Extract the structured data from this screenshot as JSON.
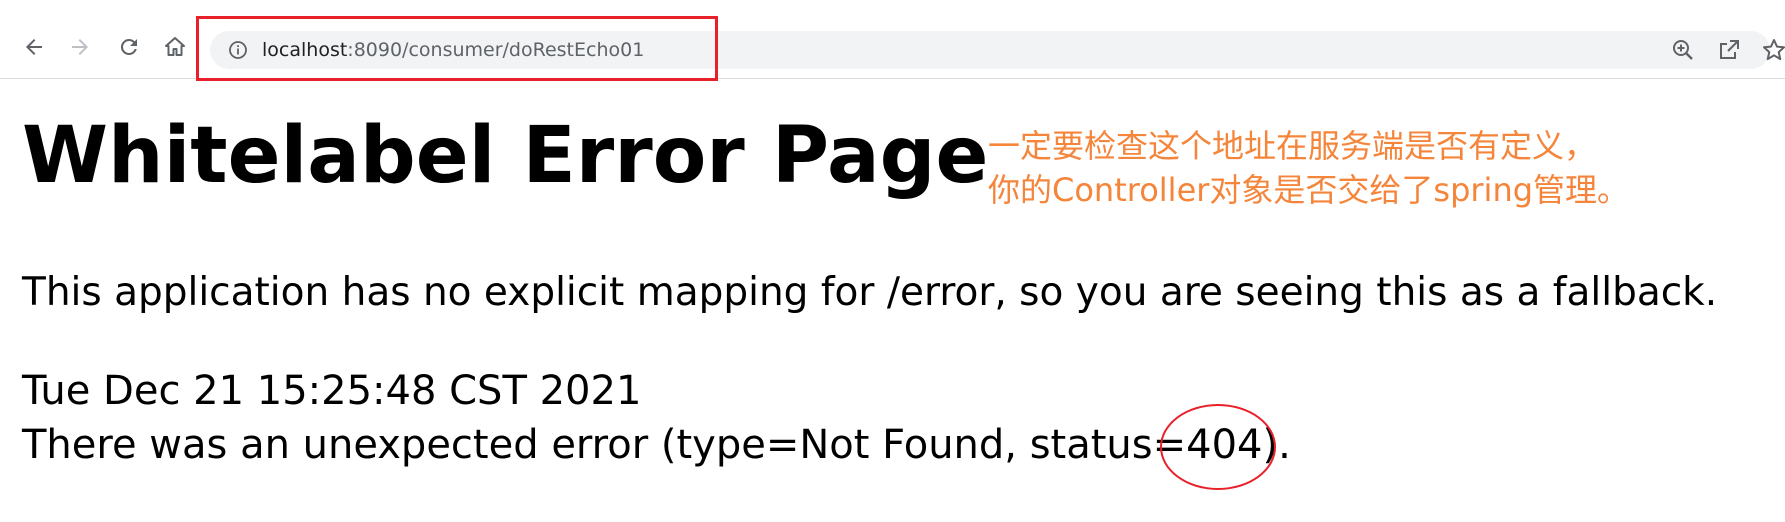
{
  "browser": {
    "back_icon": "arrow-left-icon",
    "forward_icon": "arrow-right-icon",
    "reload_icon": "reload-icon",
    "home_icon": "home-icon",
    "site_info_icon": "info-icon",
    "url_host": "localhost",
    "url_rest": ":8090/consumer/doRestEcho01",
    "zoom_icon": "zoom-in-icon",
    "share_icon": "share-icon",
    "bookmark_icon": "star-icon",
    "highlight_color": "#e8202a"
  },
  "page": {
    "title": "Whitelabel Error Page",
    "message": "This application has no explicit mapping for /error, so you are seeing this as a fallback.",
    "timestamp": "Tue Dec 21 15:25:48 CST 2021",
    "error_line": "There was an unexpected error (type=Not Found, status=404)."
  },
  "annotation": {
    "line1": "一定要检查这个地址在服务端是否有定义，",
    "line2": "你的Controller对象是否交给了spring管理。",
    "color": "#f5853b"
  }
}
